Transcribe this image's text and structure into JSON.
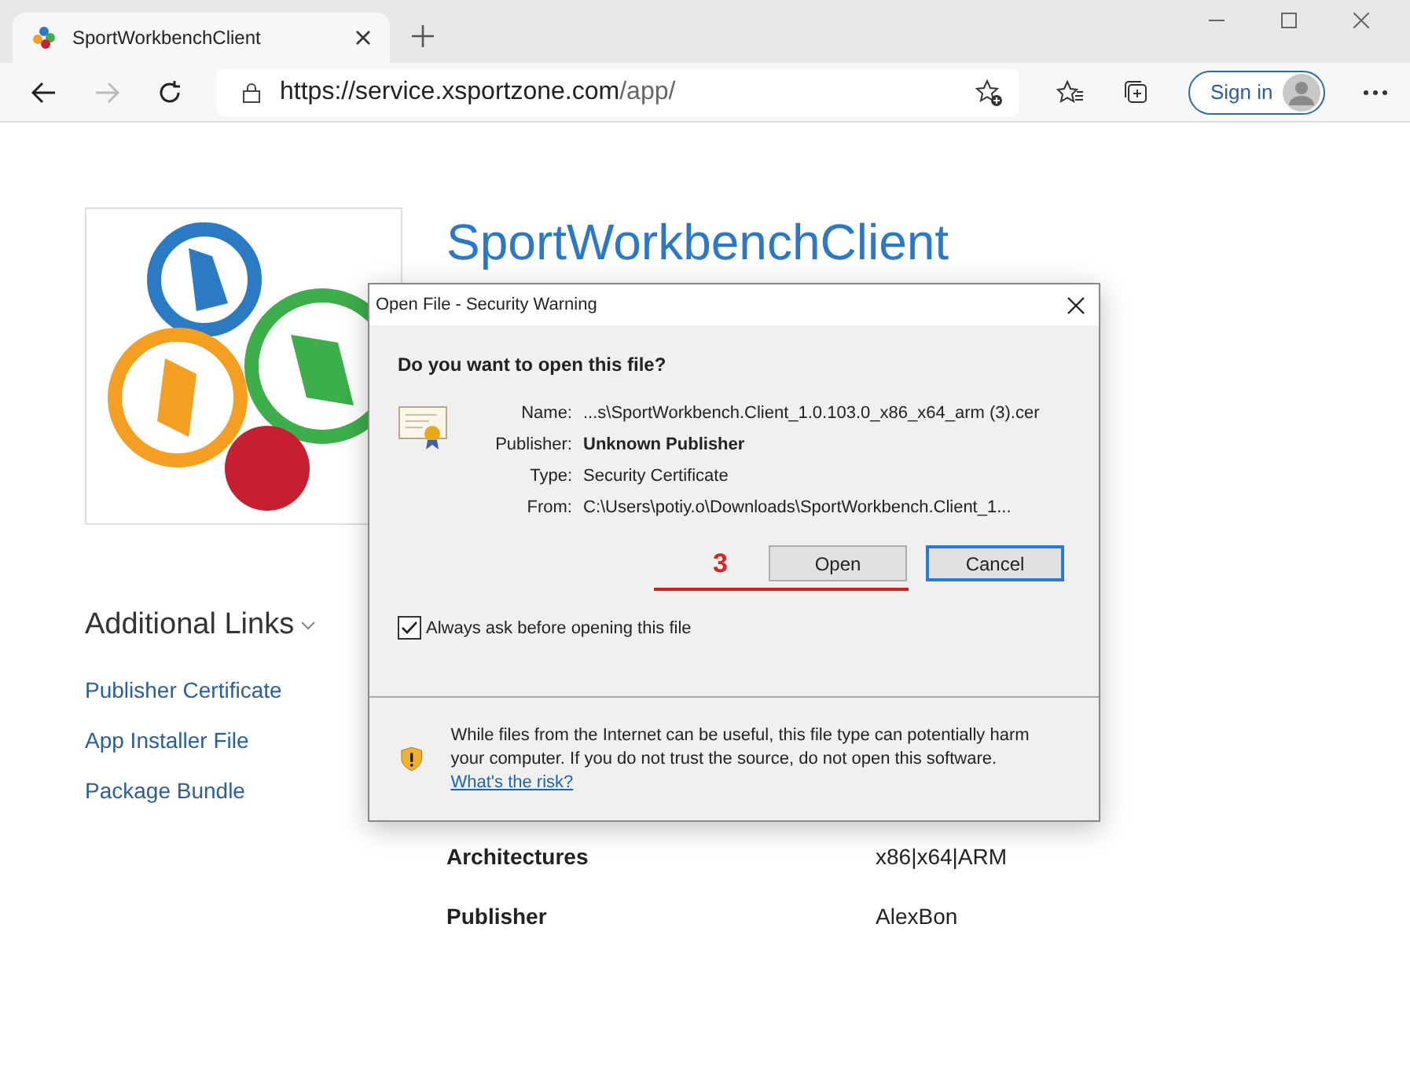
{
  "browser": {
    "tab": {
      "title": "SportWorkbenchClient"
    },
    "address": {
      "url_host": "https://service.xsportzone.com",
      "url_path": "/app/"
    },
    "sign_in": "Sign in"
  },
  "page": {
    "title": "SportWorkbenchClient",
    "links_heading": "Additional Links",
    "links": [
      "Publisher Certificate",
      "App Installer File",
      "Package Bundle"
    ],
    "details": [
      {
        "label": "Architectures",
        "value": "x86|x64|ARM"
      },
      {
        "label": "Publisher",
        "value": "AlexBon"
      }
    ]
  },
  "dialog": {
    "title": "Open File - Security Warning",
    "question": "Do you want to open this file?",
    "fields": [
      {
        "label": "Name:",
        "value": "...s\\SportWorkbench.Client_1.0.103.0_x86_x64_arm (3).cer",
        "bold": false
      },
      {
        "label": "Publisher:",
        "value": "Unknown Publisher",
        "bold": true
      },
      {
        "label": "Type:",
        "value": "Security Certificate",
        "bold": false
      },
      {
        "label": "From:",
        "value": "C:\\Users\\potiy.o\\Downloads\\SportWorkbench.Client_1...",
        "bold": false
      }
    ],
    "annotation": "3",
    "buttons": [
      {
        "label": "Open",
        "selected": false
      },
      {
        "label": "Cancel",
        "selected": true
      }
    ],
    "checkbox": {
      "label": "Always ask before opening this file",
      "checked": true
    },
    "warning": "While files from the Internet can be useful, this file type can potentially harm your computer. If you do not trust the source, do not open this software.",
    "risk_link": "What's the risk?"
  }
}
